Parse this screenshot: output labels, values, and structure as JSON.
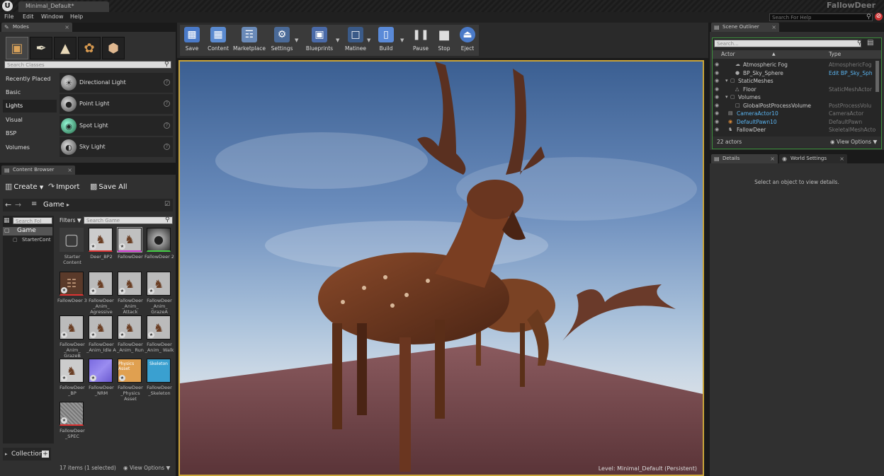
{
  "window": {
    "tab": "Minimal_Default*",
    "app_title": "FallowDeer",
    "logo": "U"
  },
  "menu": [
    "File",
    "Edit",
    "Window",
    "Help"
  ],
  "help_search": {
    "placeholder": "Search For Help"
  },
  "modes": {
    "tab": "Modes",
    "search_placeholder": "Search Classes",
    "categories": [
      "Recently Placed",
      "Basic",
      "Lights",
      "Visual",
      "BSP",
      "Volumes"
    ],
    "active_category": "Lights",
    "items": [
      {
        "label": "Directional Light"
      },
      {
        "label": "Point Light"
      },
      {
        "label": "Spot Light"
      },
      {
        "label": "Sky Light"
      }
    ]
  },
  "content_browser": {
    "tab": "Content Browser",
    "create": "Create",
    "import": "Import",
    "save_all": "Save All",
    "path": "Game",
    "folder_search_placeholder": "Search Fol",
    "tree": [
      "Game",
      "StarterCont"
    ],
    "filters": "Filters",
    "asset_search_placeholder": "Search Game",
    "assets": [
      {
        "name": "Starter Content"
      },
      {
        "name": "Deer_BP2"
      },
      {
        "name": "FallowDeer"
      },
      {
        "name": "FallowDeer 2"
      },
      {
        "name": "FallowDeer 3"
      },
      {
        "name": "FallowDeer _Anim_ Agressive"
      },
      {
        "name": "FallowDeer _Anim_ Attack"
      },
      {
        "name": "FallowDeer _Anim_ GrazeA"
      },
      {
        "name": "FallowDeer _Anim_ GrazeB"
      },
      {
        "name": "FallowDeer _Anim_Idle A"
      },
      {
        "name": "FallowDeer _Anim_ Run"
      },
      {
        "name": "FallowDeer _Anim_ Walk"
      },
      {
        "name": "FallowDeer _BP"
      },
      {
        "name": "FallowDeer _NRM"
      },
      {
        "name": "FallowDeer _Physics Asset"
      },
      {
        "name": "FallowDeer _Skeleton"
      },
      {
        "name": "FallowDeer _SPEC"
      }
    ],
    "physics_thumb_text": "Physics Asset",
    "skeleton_thumb_text": "Skeleton",
    "collections": "Collection",
    "status": "17 items (1 selected)",
    "view_options": "View Options"
  },
  "toolbar": {
    "buttons": [
      {
        "label": "Save"
      },
      {
        "label": "Content"
      },
      {
        "label": "Marketplace"
      },
      {
        "label": "Settings"
      },
      {
        "label": "Blueprints"
      },
      {
        "label": "Matinee"
      },
      {
        "label": "Build"
      },
      {
        "label": "Pause"
      },
      {
        "label": "Stop"
      },
      {
        "label": "Eject"
      }
    ]
  },
  "viewport": {
    "level": "Level:  Minimal_Default (Persistent)"
  },
  "outliner": {
    "tab": "Scene Outliner",
    "search_placeholder": "Search...",
    "col_actor": "Actor",
    "col_type": "Type",
    "rows": [
      {
        "name": "Atmospheric Fog",
        "type": "AtmosphericFog"
      },
      {
        "name": "BP_Sky_Sphere",
        "type": "Edit BP_Sky_Sph"
      },
      {
        "name": "StaticMeshes",
        "type": ""
      },
      {
        "name": "Floor",
        "type": "StaticMeshActor"
      },
      {
        "name": "Volumes",
        "type": ""
      },
      {
        "name": "GlobalPostProcessVolume",
        "type": "PostProcessVolu"
      },
      {
        "name": "CameraActor10",
        "type": "CameraActor"
      },
      {
        "name": "DefaultPawn10",
        "type": "DefaultPawn"
      },
      {
        "name": "FallowDeer",
        "type": "SkeletalMeshActo"
      }
    ],
    "count": "22 actors",
    "view_options": "View Options"
  },
  "details": {
    "tab": "Details",
    "world_tab": "World Settings",
    "empty_text": "Select an object to view details."
  }
}
